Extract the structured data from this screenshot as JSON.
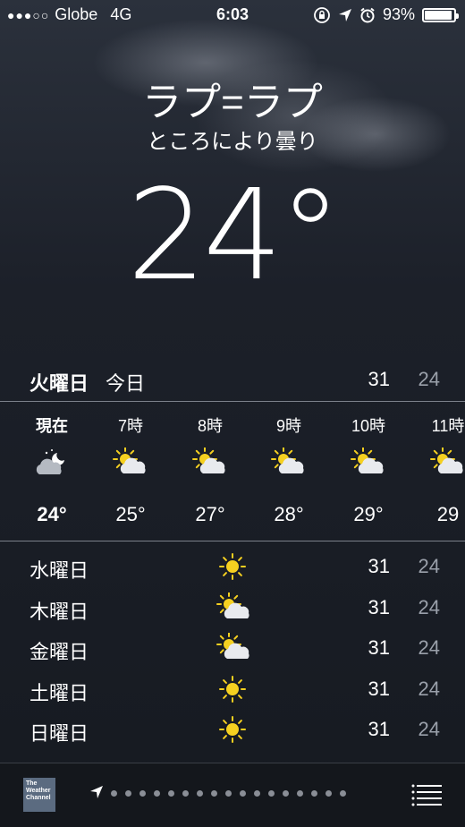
{
  "status_bar": {
    "carrier": "Globe",
    "network": "4G",
    "time": "6:03",
    "battery": "93%",
    "battery_level": 0.93,
    "signal_dots": "●●●○○",
    "icons": [
      "rotation-lock-icon",
      "location-arrow-icon",
      "alarm-icon",
      "battery-icon"
    ]
  },
  "location": {
    "city": "ラプ=ラプ",
    "condition": "ところにより曇り",
    "temperature": "24°"
  },
  "today": {
    "day": "火曜日",
    "label": "今日",
    "high": "31",
    "low": "24"
  },
  "hourly": [
    {
      "time": "現在",
      "icon": "partly-cloudy-night-icon",
      "temp": "24°",
      "current": true
    },
    {
      "time": "7時",
      "icon": "partly-cloudy-day-icon",
      "temp": "25°"
    },
    {
      "time": "8時",
      "icon": "partly-cloudy-day-icon",
      "temp": "27°"
    },
    {
      "time": "9時",
      "icon": "partly-cloudy-day-icon",
      "temp": "28°"
    },
    {
      "time": "10時",
      "icon": "partly-cloudy-day-icon",
      "temp": "29°"
    },
    {
      "time": "11時",
      "icon": "partly-cloudy-day-icon",
      "temp": "29"
    }
  ],
  "daily": [
    {
      "day": "水曜日",
      "icon": "sun-icon",
      "high": "31",
      "low": "24"
    },
    {
      "day": "木曜日",
      "icon": "partly-cloudy-day-icon",
      "high": "31",
      "low": "24"
    },
    {
      "day": "金曜日",
      "icon": "partly-cloudy-day-icon",
      "high": "31",
      "low": "24"
    },
    {
      "day": "土曜日",
      "icon": "sun-icon",
      "high": "31",
      "low": "24"
    },
    {
      "day": "日曜日",
      "icon": "sun-icon",
      "high": "31",
      "low": "24"
    }
  ],
  "bottom_bar": {
    "logo_text": "The Weather Channel",
    "page_count": 17,
    "icons": [
      "weather-channel-logo",
      "location-arrow-icon",
      "list-icon"
    ]
  },
  "colors": {
    "sun": "#f5d020",
    "cloud": "#e8eaee",
    "night_cloud": "#b5bac2",
    "low_temp": "#9aa0aa"
  }
}
